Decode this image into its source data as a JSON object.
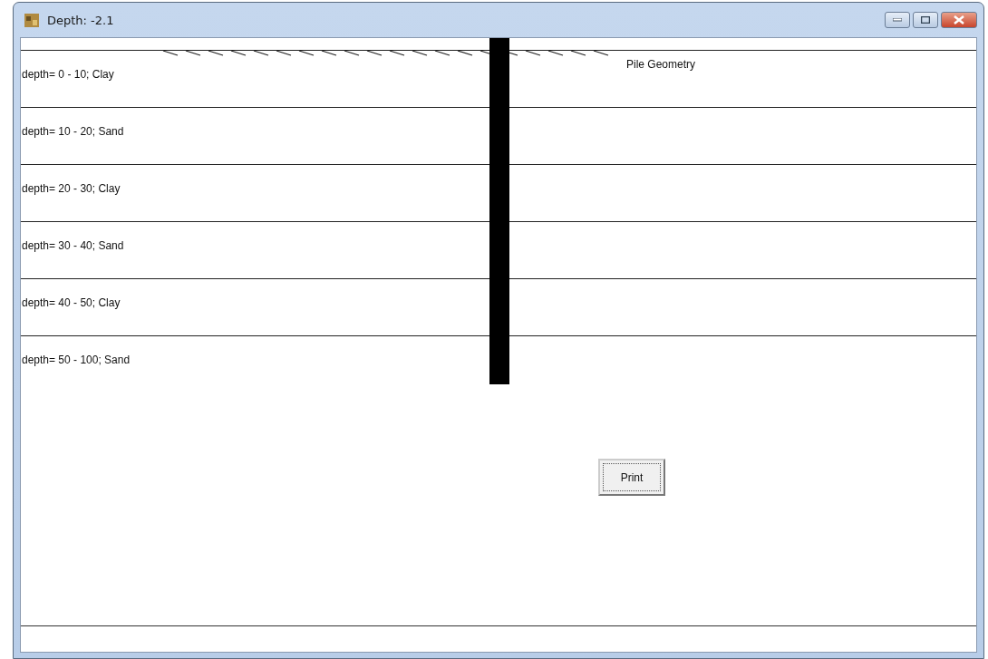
{
  "window": {
    "title": "Depth: -2.1"
  },
  "layers": [
    {
      "label": "depth= 0 - 10; Clay"
    },
    {
      "label": "depth= 10 - 20; Sand"
    },
    {
      "label": "depth= 20 - 30; Clay"
    },
    {
      "label": "depth= 30 - 40; Sand"
    },
    {
      "label": "depth= 40 - 50; Clay"
    },
    {
      "label": "depth= 50 - 100; Sand"
    }
  ],
  "caption": "Pile Geometry",
  "print_button": "Print"
}
